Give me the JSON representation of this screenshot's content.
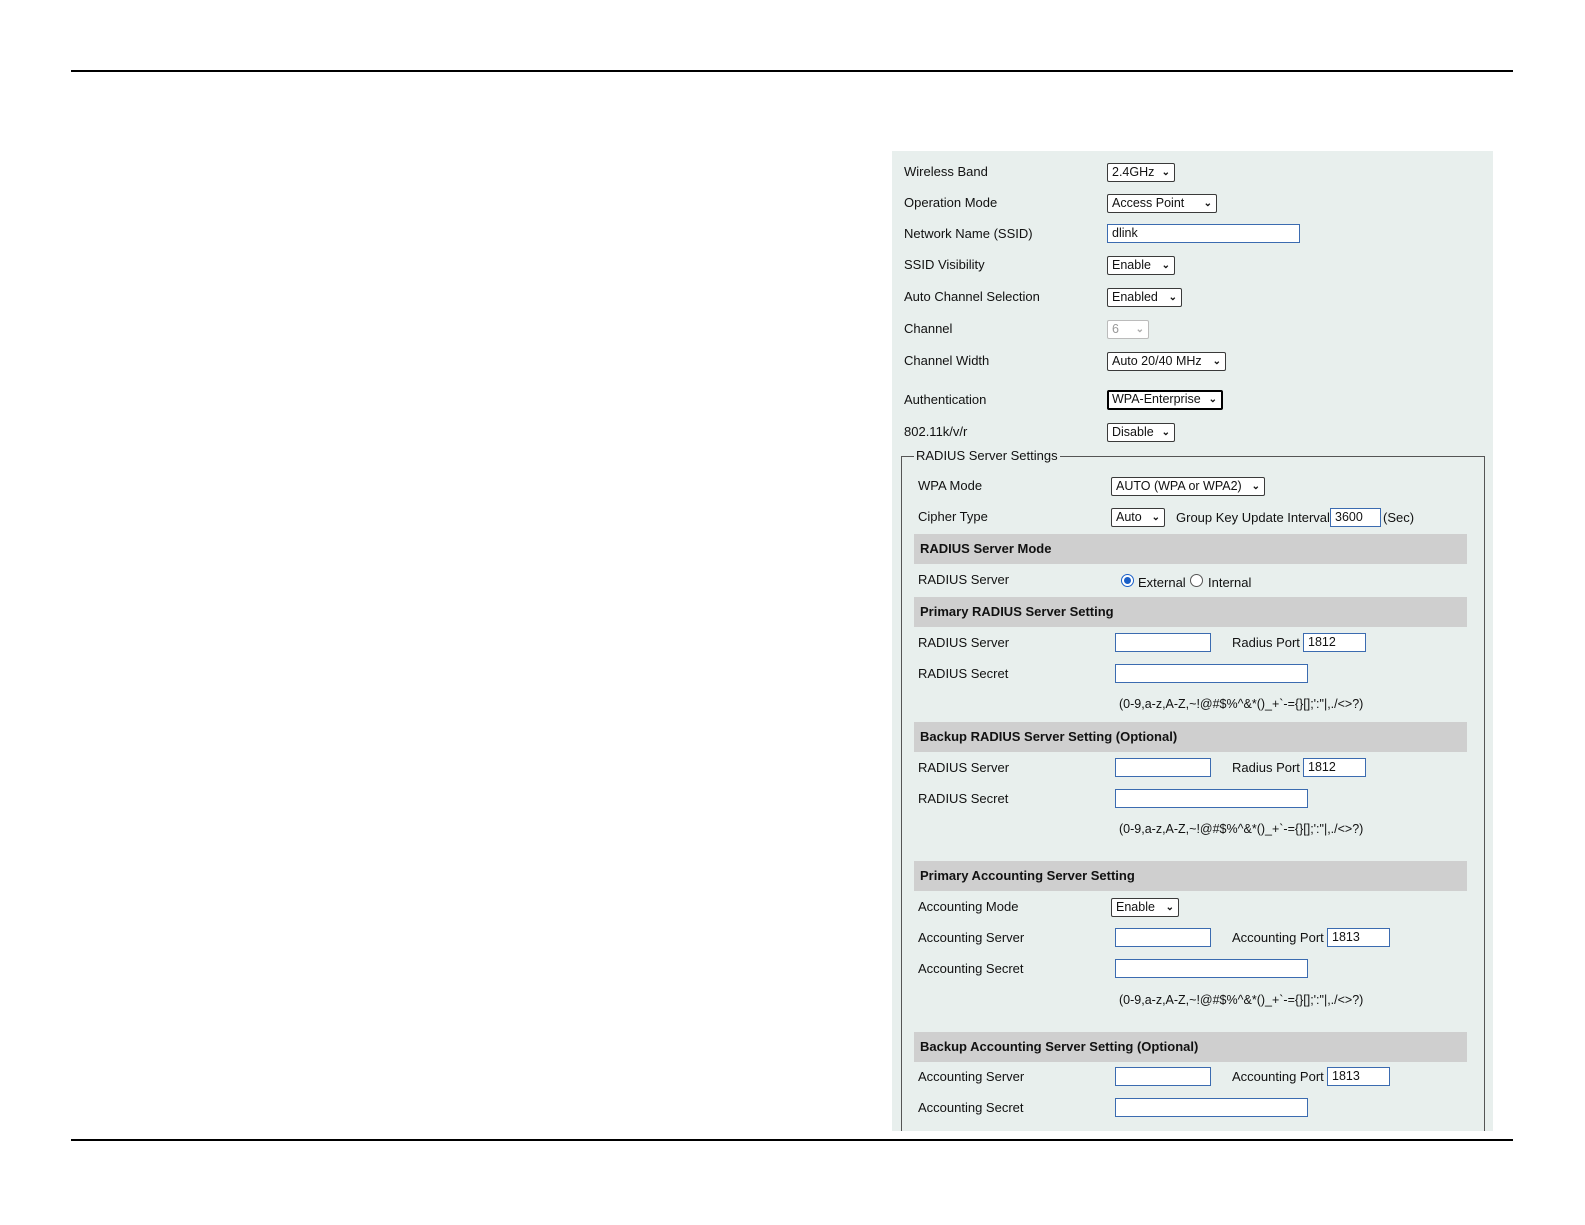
{
  "wireless": {
    "band_label": "Wireless Band",
    "band_value": "2.4GHz",
    "op_mode_label": "Operation Mode",
    "op_mode_value": "Access Point",
    "ssid_label": "Network Name (SSID)",
    "ssid_value": "dlink",
    "ssid_vis_label": "SSID Visibility",
    "ssid_vis_value": "Enable",
    "auto_channel_label": "Auto Channel Selection",
    "auto_channel_value": "Enabled",
    "channel_label": "Channel",
    "channel_value": "6",
    "channel_width_label": "Channel Width",
    "channel_width_value": "Auto 20/40 MHz",
    "auth_label": "Authentication",
    "auth_value": "WPA-Enterprise",
    "kvr_label": "802.11k/v/r",
    "kvr_value": "Disable"
  },
  "radius": {
    "legend": "RADIUS Server Settings",
    "wpa_mode_label": "WPA Mode",
    "wpa_mode_value": "AUTO (WPA or WPA2)",
    "cipher_label": "Cipher Type",
    "cipher_value": "Auto",
    "gk_label": "Group Key Update Interval",
    "gk_value": "3600",
    "gk_unit": "(Sec)",
    "mode_header": "RADIUS Server Mode",
    "server_mode_label": "RADIUS Server",
    "external_label": "External",
    "internal_label": "Internal",
    "server_mode_selected": "External",
    "primary_header": "Primary RADIUS Server Setting",
    "primary_server_label": "RADIUS Server",
    "primary_server_value": "",
    "primary_port_label": "Radius Port",
    "primary_port_value": "1812",
    "primary_secret_label": "RADIUS Secret",
    "primary_secret_value": "",
    "primary_hint": "(0-9,a-z,A-Z,~!@#$%^&*()_+`-={}[];':\"|,./<>?)",
    "backup_header": "Backup RADIUS Server Setting (Optional)",
    "backup_server_label": "RADIUS Server",
    "backup_server_value": "",
    "backup_port_label": "Radius Port",
    "backup_port_value": "1812",
    "backup_secret_label": "RADIUS Secret",
    "backup_secret_value": "",
    "backup_hint": "(0-9,a-z,A-Z,~!@#$%^&*()_+`-={}[];':\"|,./<>?)"
  },
  "accounting": {
    "primary_header": "Primary Accounting Server Setting",
    "mode_label": "Accounting Mode",
    "mode_value": "Enable",
    "primary_server_label": "Accounting Server",
    "primary_server_value": "",
    "primary_port_label": "Accounting Port",
    "primary_port_value": "1813",
    "primary_secret_label": "Accounting Secret",
    "primary_secret_value": "",
    "primary_hint": "(0-9,a-z,A-Z,~!@#$%^&*()_+`-={}[];':\"|,./<>?)",
    "backup_header": "Backup Accounting Server Setting (Optional)",
    "backup_server_label": "Accounting Server",
    "backup_server_value": "",
    "backup_port_label": "Accounting Port",
    "backup_port_value": "1813",
    "backup_secret_label": "Accounting Secret",
    "backup_secret_value": ""
  }
}
